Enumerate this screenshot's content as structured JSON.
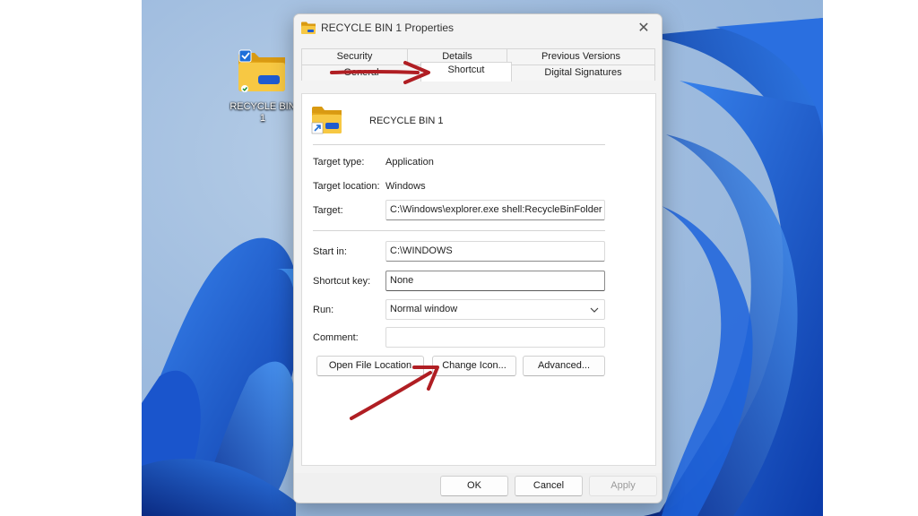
{
  "desktop": {
    "icon_label": "RECYCLE BIN 1"
  },
  "dialog": {
    "title": "RECYCLE BIN 1 Properties",
    "tabs": {
      "security": "Security",
      "details": "Details",
      "previous_versions": "Previous Versions",
      "general": "General",
      "shortcut": "Shortcut",
      "digital_signatures": "Digital Signatures"
    },
    "shortcut_name": "RECYCLE BIN 1",
    "fields": {
      "target_type_label": "Target type:",
      "target_type_value": "Application",
      "target_location_label": "Target location:",
      "target_location_value": "Windows",
      "target_label": "Target:",
      "target_value": "C:\\Windows\\explorer.exe shell:RecycleBinFolder",
      "start_in_label": "Start in:",
      "start_in_value": "C:\\WINDOWS",
      "shortcut_key_label": "Shortcut key:",
      "shortcut_key_value": "None",
      "run_label": "Run:",
      "run_value": "Normal window",
      "comment_label": "Comment:",
      "comment_value": ""
    },
    "buttons": {
      "open_file_location": "Open File Location",
      "change_icon": "Change Icon...",
      "advanced": "Advanced...",
      "ok": "OK",
      "cancel": "Cancel",
      "apply": "Apply"
    }
  },
  "colors": {
    "annotation_arrow": "#b01e23",
    "wallpaper_blue": "#1f5fd8",
    "folder_yellow": "#f5c33b"
  }
}
